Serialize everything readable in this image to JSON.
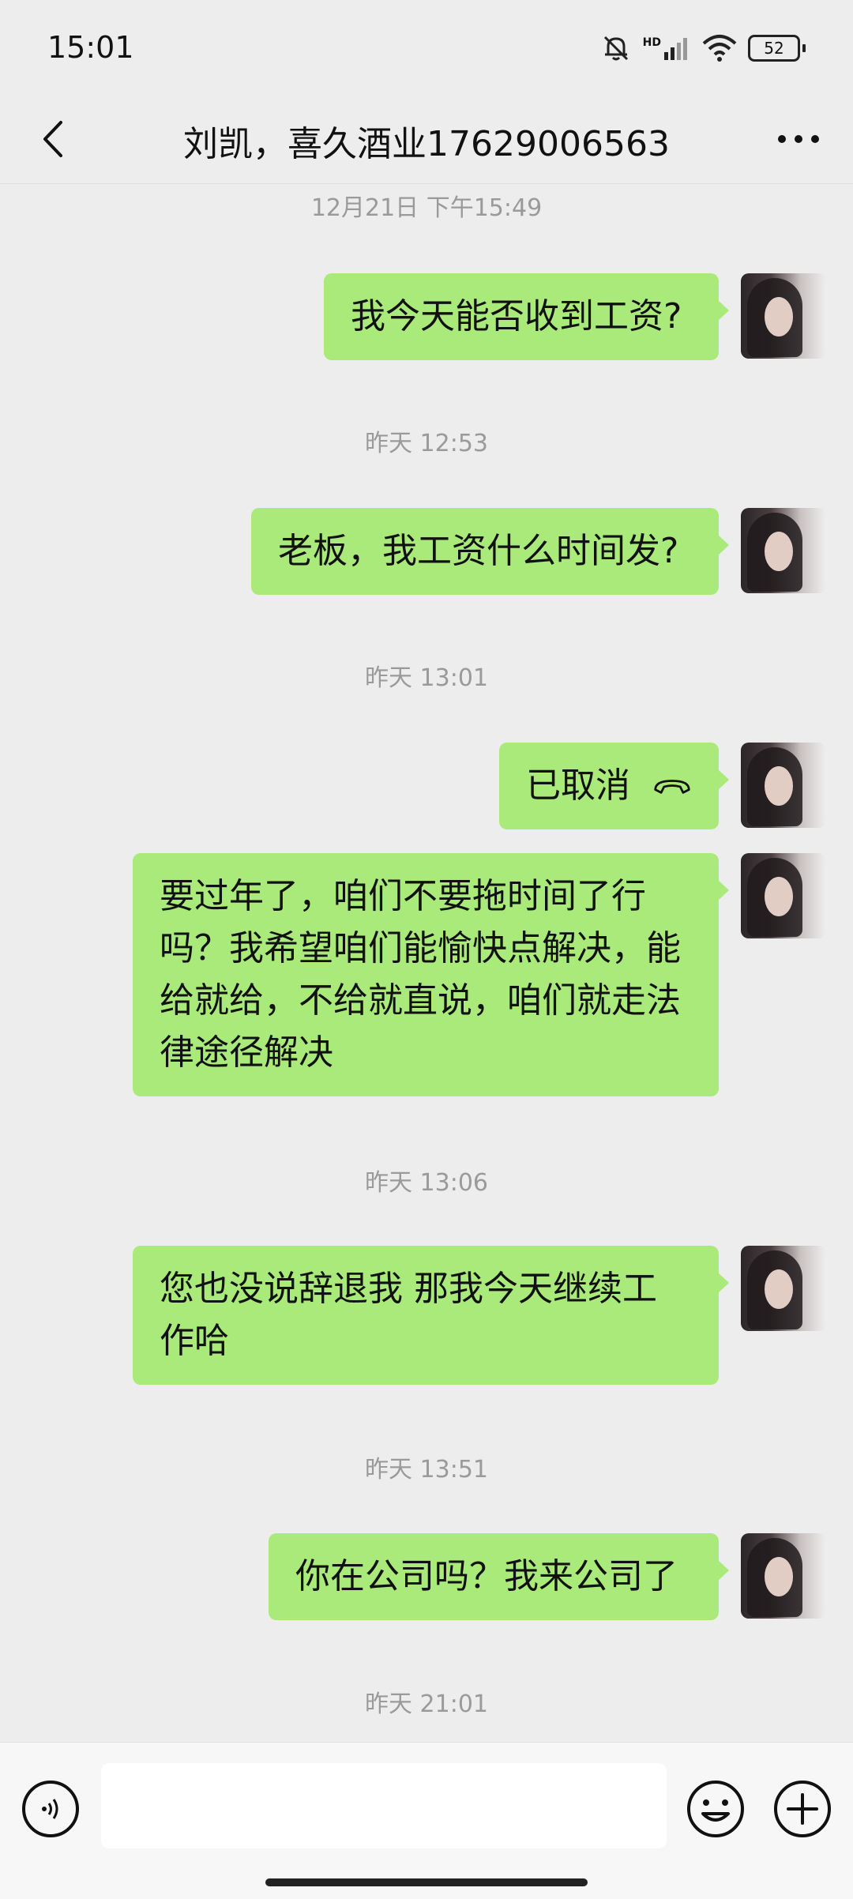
{
  "status_bar": {
    "time": "15:01",
    "network_badge": "HD",
    "battery_level": "52",
    "icons": [
      "bell-muted-icon",
      "signal-icon",
      "wifi-icon",
      "battery-icon"
    ]
  },
  "header": {
    "title": "刘凯，喜久酒业17629006563",
    "back_icon": "chevron-left-icon",
    "more_icon": "more-dots-icon"
  },
  "chat": {
    "timestamps": [
      "12月21日 下午15:49",
      "昨天 12:53",
      "昨天 13:01",
      "昨天 13:06",
      "昨天 13:51",
      "昨天 21:01"
    ],
    "messages": [
      {
        "sender": "me",
        "text": "我今天能否收到工资?"
      },
      {
        "sender": "me",
        "text": "老板，我工资什么时间发?"
      },
      {
        "sender": "me",
        "text": "已取消",
        "icon": "phone-hangup-icon"
      },
      {
        "sender": "me",
        "lines": [
          "要过年了，咱们不要拖时间了行",
          "吗？我希望咱们能愉快点解决，能",
          "给就给，不给就直说，咱们就走法",
          "律途径解决"
        ]
      },
      {
        "sender": "me",
        "lines": [
          "您也没说辞退我 那我今天继续工",
          "作哈"
        ]
      },
      {
        "sender": "me",
        "text": "你在公司吗？我来公司了"
      }
    ]
  },
  "input_bar": {
    "voice_icon": "voice-icon",
    "input_value": "",
    "emoji_icon": "emoji-icon",
    "plus_icon": "plus-icon"
  },
  "colors": {
    "background": "#ededed",
    "bubble_green": "#a9ea7a",
    "timestamp_gray": "#9a9a9a"
  }
}
